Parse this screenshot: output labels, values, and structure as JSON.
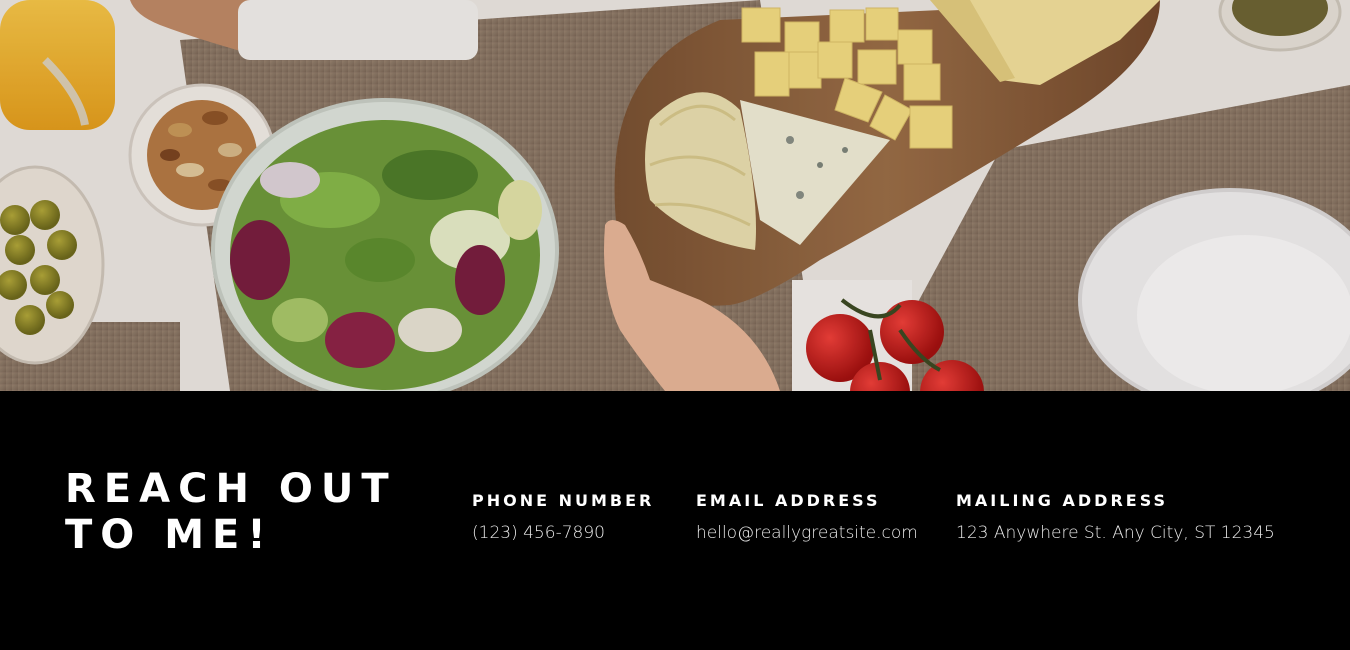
{
  "hero": {
    "image": "table-with-salad-cheese-board-and-tomatoes"
  },
  "contact": {
    "heading_line1": "REACH OUT",
    "heading_line2": "TO ME!",
    "phone": {
      "label": "PHONE NUMBER",
      "value": "(123) 456-7890"
    },
    "email": {
      "label": "EMAIL ADDRESS",
      "value": "hello@reallygreatsite.com"
    },
    "mailing": {
      "label": "MAILING ADDRESS",
      "value": "123 Anywhere St. Any City, ST 12345"
    }
  },
  "colors": {
    "background": "#000000",
    "text": "#ffffff",
    "table": "#8a7563"
  }
}
